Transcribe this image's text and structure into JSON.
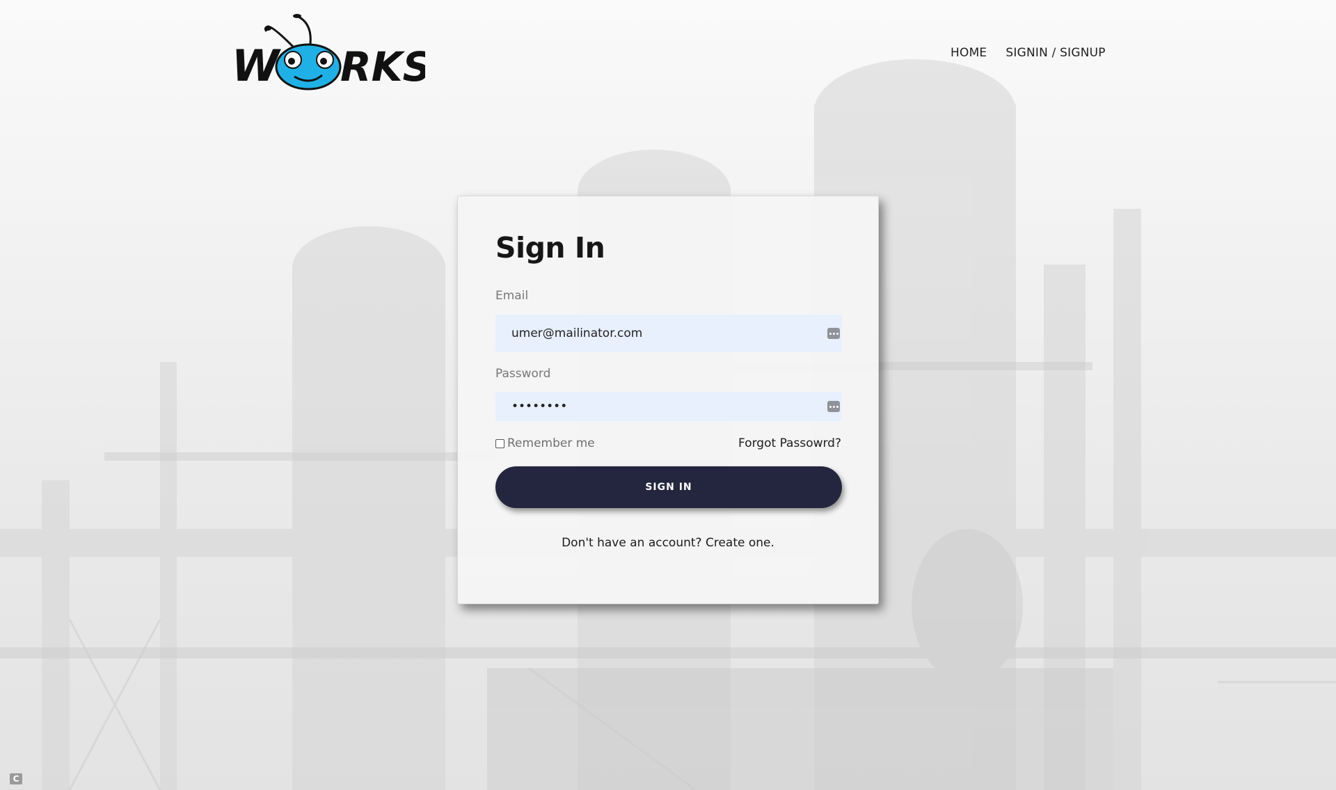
{
  "brand": {
    "logo_text": "WORKS",
    "colors": {
      "logo_black": "#111111",
      "logo_blue": "#1fb1e6"
    }
  },
  "nav": {
    "items": [
      {
        "label": "HOME"
      },
      {
        "label": "SIGNIN / SIGNUP"
      }
    ]
  },
  "signin": {
    "title": "Sign In",
    "email_label": "Email",
    "email_value": "umer@mailinator.com",
    "password_label": "Password",
    "password_value": "••••••••",
    "remember_label": "Remember me",
    "remember_checked": false,
    "forgot_label": "Forgot Passowrd?",
    "button_label": "SIGN IN",
    "create_account": "Don't have an account? Create one.",
    "password_manager_icon": "dots-icon"
  },
  "theme": {
    "button_bg": "#24263f",
    "input_bg": "#e8effd",
    "card_bg": "#f5f5f5"
  },
  "corner_icon": "c-icon"
}
